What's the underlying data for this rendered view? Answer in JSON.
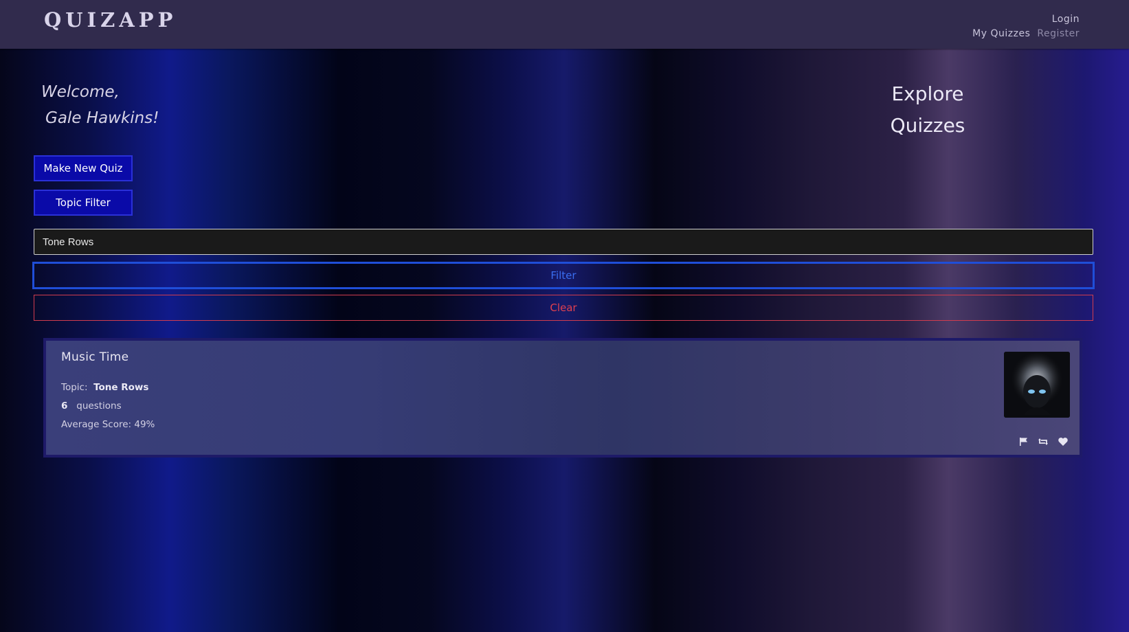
{
  "navbar": {
    "logo": "QUIZAPP",
    "login": "Login",
    "my_quizzes": "My Quizzes",
    "register": "Register"
  },
  "welcome": {
    "line1": "Welcome,",
    "name": "Gale Hawkins!"
  },
  "heading": {
    "line1": "Explore",
    "line2": "Quizzes"
  },
  "actions": {
    "new_quiz": "Make New Quiz",
    "topic_filter": "Topic Filter"
  },
  "filter": {
    "input_value": "Tone Rows",
    "filter_label": "Filter",
    "clear_label": "Clear"
  },
  "quizzes": [
    {
      "title": "Music Time",
      "topic_label": "Topic:",
      "topic": "Tone Rows",
      "question_count": "6",
      "questions_label": "questions",
      "average_score": "Average Score: 49%",
      "icons": [
        "flag-icon",
        "retweet-icon",
        "heart-icon"
      ]
    }
  ],
  "colors": {
    "navbar": "#312b4d",
    "primary_button": "#0a0aa8",
    "filter_accent": "#1f4ed8",
    "clear_accent": "#d23c4e",
    "card_border": "#1e1a68"
  }
}
